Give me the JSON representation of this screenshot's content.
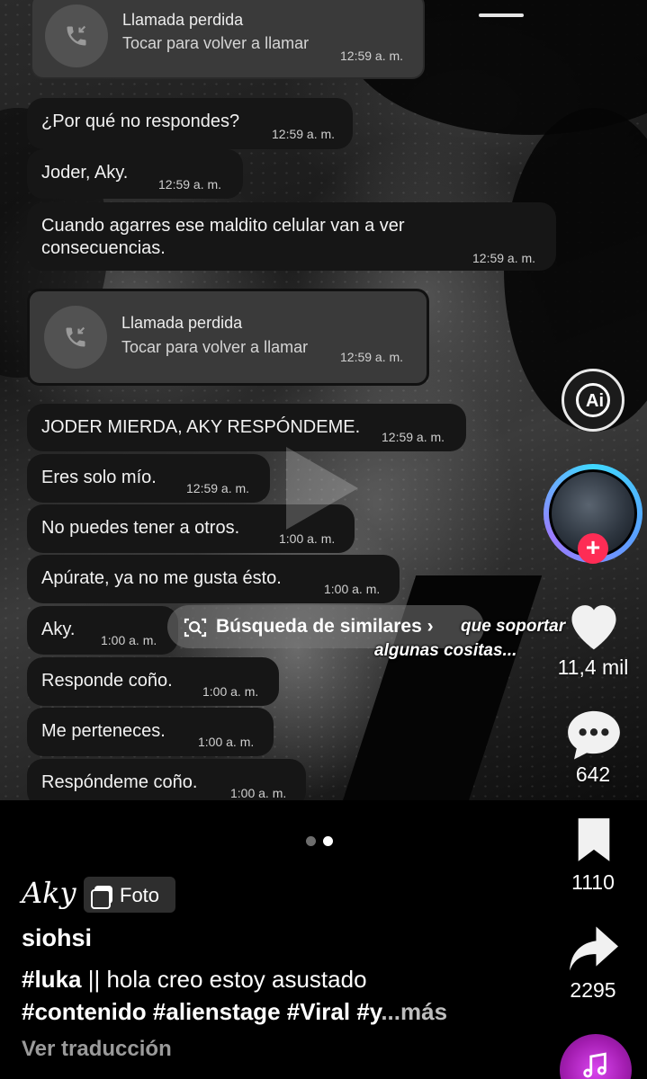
{
  "missed_calls": [
    {
      "title": "Llamada perdida",
      "subtitle": "Tocar para volver a llamar",
      "time": "12:59 a. m."
    },
    {
      "title": "Llamada perdida",
      "subtitle": "Tocar para volver a llamar",
      "time": "12:59 a. m."
    }
  ],
  "messages": [
    {
      "text": "¿Por qué no respondes?",
      "time": "12:59 a. m."
    },
    {
      "text": "Joder, Aky.",
      "time": "12:59 a. m."
    },
    {
      "line1": "Cuando agarres ese maldito celular van a ver",
      "line2": "consecuencias.",
      "time": "12:59 a. m."
    },
    {
      "text": "JODER MIERDA, AKY RESPÓNDEME.",
      "time": "12:59 a. m."
    },
    {
      "text": "Eres solo mío.",
      "time": "12:59 a. m."
    },
    {
      "text": "No puedes tener a otros.",
      "time": "1:00 a. m."
    },
    {
      "text": "Apúrate, ya no me gusta ésto.",
      "time": "1:00 a. m."
    },
    {
      "text": "Aky.",
      "time": "1:00 a. m."
    },
    {
      "text": "Responde coño.",
      "time": "1:00 a. m."
    },
    {
      "text": "Me perteneces.",
      "time": "1:00 a. m."
    },
    {
      "text": "Respóndeme coño.",
      "time": "1:00 a. m."
    }
  ],
  "search_similar": {
    "label": "Búsqueda de similares",
    "chevron": "›"
  },
  "overlay": {
    "line1": "que soportar",
    "line2": "algunas cositas..."
  },
  "rail": {
    "ai_label": "Ai",
    "likes": "11,4 mil",
    "comments": "642",
    "saves": "1110",
    "shares": "2295",
    "accent": "#fe2c55"
  },
  "carousel": {
    "active": 2,
    "count": 2
  },
  "post": {
    "author": "Aky",
    "badge": "Foto",
    "username": "siohsi",
    "desc_line1_tag": "#luka",
    "desc_line1_rest": " || hola creo estoy asustado",
    "desc_line2": "#contenido #alienstage #Viral #y",
    "more": "...más",
    "translate": "Ver traducción"
  },
  "icons": [
    "call-missed-icon",
    "search-image-icon",
    "heart-icon",
    "comment-icon",
    "bookmark-icon",
    "share-icon",
    "plus-icon",
    "music-icon"
  ]
}
